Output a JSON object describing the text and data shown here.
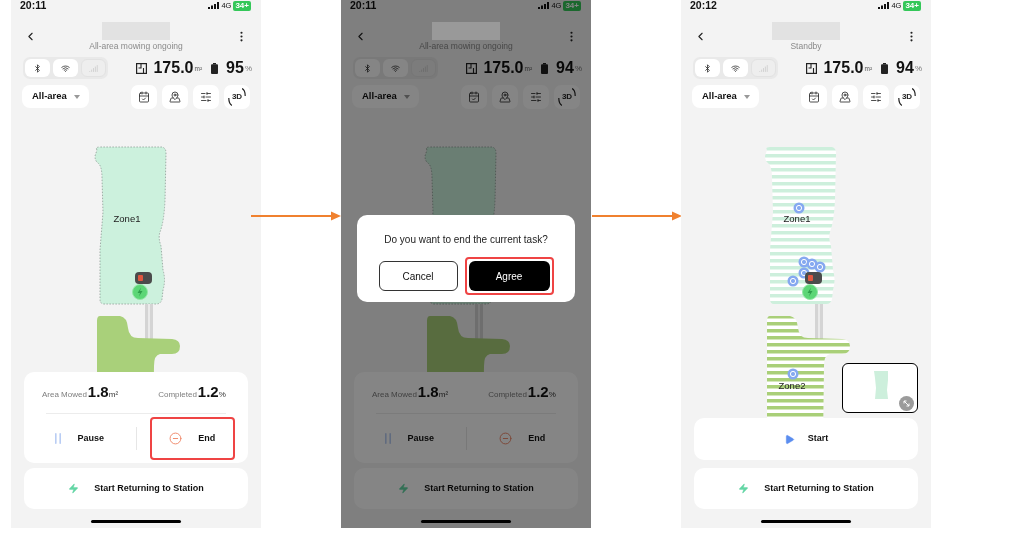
{
  "screens": [
    {
      "status_bar": {
        "time": "20:11",
        "network": "4G",
        "battery": "34+"
      },
      "header": {
        "subtitle": "All-area mowing ongoing"
      },
      "connectivity": [
        {
          "kind": "bluetooth",
          "on": true
        },
        {
          "kind": "wifi",
          "on": true
        },
        {
          "kind": "cellular",
          "on": false
        }
      ],
      "summary": {
        "area": "175.0",
        "area_unit": "m²",
        "battery": "95",
        "battery_unit": "%"
      },
      "zone_dropdown": "All-area",
      "toolbar": [
        {
          "kind": "schedule"
        },
        {
          "kind": "map"
        },
        {
          "kind": "adjust"
        },
        {
          "kind": "view_3d",
          "label": "3D"
        }
      ],
      "map": {
        "kind": "mowing",
        "zone_labels": [
          "Zone1"
        ]
      },
      "task_panel": {
        "stats": [
          {
            "label": "Area Mowed",
            "value": "1.8",
            "unit": "m²"
          },
          {
            "label": "Completed",
            "value": "1.2",
            "unit": "%"
          }
        ],
        "controls": [
          {
            "kind": "pause",
            "label": "Pause",
            "highlighted": false
          },
          {
            "kind": "end",
            "label": "End",
            "highlighted": true
          }
        ]
      },
      "return_button": "Start Returning to Station"
    },
    {
      "status_bar": {
        "time": "20:11",
        "network": "4G",
        "battery": "34+"
      },
      "header": {
        "subtitle": "All-area mowing ongoing"
      },
      "connectivity": [
        {
          "kind": "bluetooth",
          "on": true
        },
        {
          "kind": "wifi",
          "on": true
        },
        {
          "kind": "cellular",
          "on": false
        }
      ],
      "summary": {
        "area": "175.0",
        "area_unit": "m²",
        "battery": "94",
        "battery_unit": "%"
      },
      "zone_dropdown": "All-area",
      "toolbar": [
        {
          "kind": "schedule"
        },
        {
          "kind": "map"
        },
        {
          "kind": "adjust"
        },
        {
          "kind": "view_3d",
          "label": "3D"
        }
      ],
      "map": {
        "kind": "mowing"
      },
      "task_panel": {
        "stats": [
          {
            "label": "Area Mowed",
            "value": "1.8",
            "unit": "m²"
          },
          {
            "label": "Completed",
            "value": "1.2",
            "unit": "%"
          }
        ],
        "controls": [
          {
            "kind": "pause",
            "label": "Pause",
            "highlighted": false
          },
          {
            "kind": "end",
            "label": "End",
            "highlighted": false
          }
        ]
      },
      "return_button": "Start Returning to Station",
      "dialog": {
        "message": "Do you want to end the current task?",
        "buttons": [
          {
            "kind": "secondary",
            "label": "Cancel",
            "highlighted": false
          },
          {
            "kind": "primary",
            "label": "Agree",
            "highlighted": true
          }
        ]
      }
    },
    {
      "status_bar": {
        "time": "20:12",
        "network": "4G",
        "battery": "34+"
      },
      "header": {
        "subtitle": "Standby"
      },
      "connectivity": [
        {
          "kind": "bluetooth",
          "on": true
        },
        {
          "kind": "wifi",
          "on": true
        },
        {
          "kind": "cellular",
          "on": false
        }
      ],
      "summary": {
        "area": "175.0",
        "area_unit": "m²",
        "battery": "94",
        "battery_unit": "%"
      },
      "zone_dropdown": "All-area",
      "toolbar": [
        {
          "kind": "schedule"
        },
        {
          "kind": "map"
        },
        {
          "kind": "adjust"
        },
        {
          "kind": "view_3d",
          "label": "3D"
        }
      ],
      "map": {
        "kind": "standby",
        "zone_labels": [
          "Zone1",
          "Zone2"
        ],
        "minimap": true
      },
      "start_button": "Start",
      "return_button": "Start Returning to Station"
    }
  ]
}
